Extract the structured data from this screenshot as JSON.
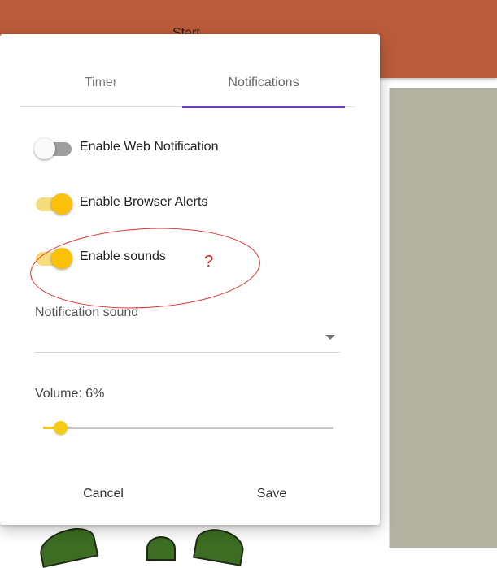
{
  "header": {
    "start_label": "Start"
  },
  "tabs": [
    {
      "label": "Timer",
      "active": false
    },
    {
      "label": "Notifications",
      "active": true
    }
  ],
  "settings": {
    "web_notification": {
      "label": "Enable Web Notification",
      "enabled": false
    },
    "browser_alerts": {
      "label": "Enable Browser Alerts",
      "enabled": true
    },
    "sounds": {
      "label": "Enable sounds",
      "enabled": true
    }
  },
  "annotation": {
    "text": "?",
    "color": "#e02a2a"
  },
  "notification_sound": {
    "label": "Notification sound",
    "value": ""
  },
  "volume": {
    "label": "Volume: 6%",
    "percent": 6
  },
  "actions": {
    "cancel_label": "Cancel",
    "save_label": "Save"
  },
  "colors": {
    "accent": "#6b3fbd",
    "toggle_on": "#fbc10a",
    "header": "#b95c3b"
  }
}
